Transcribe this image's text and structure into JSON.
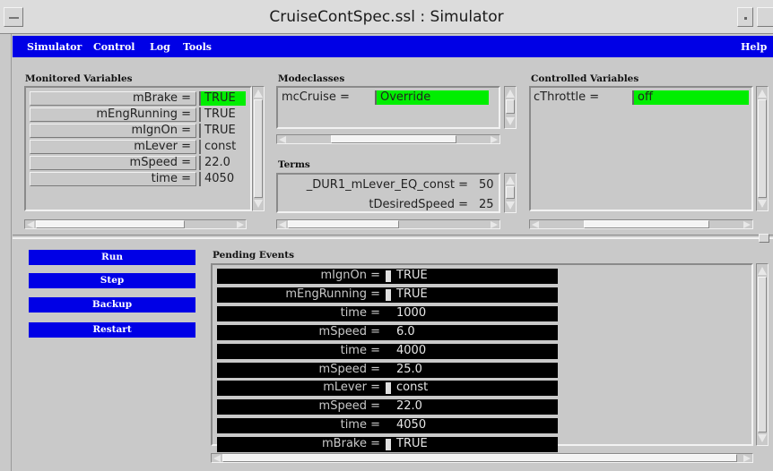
{
  "window": {
    "title": "CruiseContSpec.ssl : Simulator"
  },
  "menu": {
    "simulator": "Simulator",
    "control": "Control",
    "log": "Log",
    "tools": "Tools",
    "help": "Help"
  },
  "monitored": {
    "label": "Monitored Variables",
    "rows": [
      {
        "name": "mBrake =",
        "value": "TRUE",
        "highlight": true
      },
      {
        "name": "mEngRunning =",
        "value": "TRUE",
        "highlight": false
      },
      {
        "name": "mIgnOn =",
        "value": "TRUE",
        "highlight": false
      },
      {
        "name": "mLever =",
        "value": "const",
        "highlight": false
      },
      {
        "name": "mSpeed =",
        "value": "22.0",
        "highlight": false
      },
      {
        "name": "time =",
        "value": "4050",
        "highlight": false
      }
    ]
  },
  "modeclasses": {
    "label": "Modeclasses",
    "rows": [
      {
        "name": "mcCruise =",
        "value": "Override"
      }
    ]
  },
  "terms": {
    "label": "Terms",
    "rows": [
      {
        "name": "_DUR1_mLever_EQ_const =",
        "value": "50"
      },
      {
        "name": "tDesiredSpeed =",
        "value": "25"
      }
    ]
  },
  "controlled": {
    "label": "Controlled Variables",
    "rows": [
      {
        "name": "cThrottle =",
        "value": "off"
      }
    ]
  },
  "controls": {
    "run": "Run",
    "step": "Step",
    "backup": "Backup",
    "restart": "Restart"
  },
  "pending": {
    "label": "Pending Events",
    "events": [
      {
        "name": "mIgnOn =",
        "value": "TRUE",
        "style": "boxed"
      },
      {
        "name": "mEngRunning =",
        "value": "TRUE",
        "style": "boxed"
      },
      {
        "name": "time =",
        "value": "1000",
        "style": "plain"
      },
      {
        "name": "mSpeed =",
        "value": "6.0",
        "style": "plain"
      },
      {
        "name": "time =",
        "value": "4000",
        "style": "plain"
      },
      {
        "name": "mSpeed =",
        "value": "25.0",
        "style": "plain"
      },
      {
        "name": "mLever =",
        "value": "const",
        "style": "boxed"
      },
      {
        "name": "mSpeed =",
        "value": "22.0",
        "style": "plain"
      },
      {
        "name": "time =",
        "value": "4050",
        "style": "plain"
      },
      {
        "name": "mBrake =",
        "value": "TRUE",
        "style": "boxed"
      }
    ]
  },
  "colors": {
    "accent_blue": "#0000e6",
    "highlight_green": "#00ee00",
    "background_gray": "#c9c9c9"
  }
}
